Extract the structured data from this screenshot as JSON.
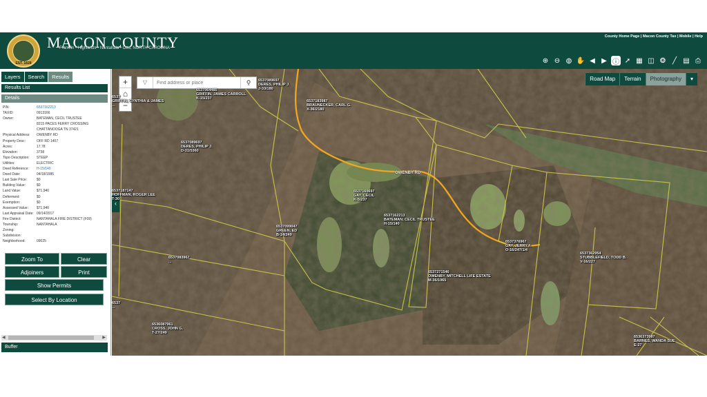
{
  "header": {
    "title": "MACON COUNTY",
    "subtitle": "Franklin • Highlands • Nantahala • Otto, NORTH CAROLINA",
    "seal_year": "EST. 1828",
    "links": [
      "County Home Page",
      "Macon County Tax",
      "Mobile",
      "Help"
    ],
    "tools": [
      "zoom-in-icon",
      "zoom-out-icon",
      "full-extent-icon",
      "pan-hand-icon",
      "previous-extent-icon",
      "next-extent-icon",
      "identify-icon",
      "select-arrow-icon",
      "map-layers-icon",
      "measure-area-icon",
      "streetview-icon",
      "measure-line-icon",
      "document-icon",
      "print-icon"
    ],
    "colors": {
      "header": "#0f4a3e",
      "accent": "#6d8a83"
    }
  },
  "sidebar": {
    "tabs": [
      "Layers",
      "Search",
      "Results"
    ],
    "active_tab": "Results",
    "results_list_label": "Results List",
    "details_label": "Details",
    "fields": [
      {
        "label": "PIN:",
        "value": "6537162213",
        "link": true
      },
      {
        "label": "TAXID:",
        "value": "0913166"
      },
      {
        "label": "Owner:",
        "value": "BATEMAN, CECIL TRUSTEE"
      },
      {
        "label": "",
        "value": "8215 PACES FERRY CROSSING"
      },
      {
        "label": "",
        "value": "CHATTANOOGA TN 37421"
      },
      {
        "label": "Physical Address:",
        "value": "OWENBY RD"
      },
      {
        "label": "Property Desc:",
        "value": "OFF RD 1407"
      },
      {
        "label": "Acres:",
        "value": "17.78"
      },
      {
        "label": "Elevation:",
        "value": "3738"
      },
      {
        "label": "Topo Description:",
        "value": "STEEP"
      },
      {
        "label": "Utilities:",
        "value": "ELECTRIC"
      },
      {
        "label": "Deed Reference:",
        "value": "H-15/140",
        "link": true
      },
      {
        "label": "Deed Date:",
        "value": "04/18/1985"
      },
      {
        "label": "Last Sale Price:",
        "value": "$0"
      },
      {
        "label": "Building Value:",
        "value": "$0"
      },
      {
        "label": "Land Value:",
        "value": "$71,940"
      },
      {
        "label": "Deferment:",
        "value": "$0"
      },
      {
        "label": "Exemption:",
        "value": "$0"
      },
      {
        "label": "Assessed Value:",
        "value": "$71,940"
      },
      {
        "label": "Last Appraisal Date:",
        "value": "09/14/2017"
      },
      {
        "label": "Fire District:",
        "value": "NANTAHALA FIRE DISTRICT (F09)"
      },
      {
        "label": "Township:",
        "value": "NANTAHALA"
      },
      {
        "label": "Zoning:",
        "value": ""
      },
      {
        "label": "Subdivision:",
        "value": ""
      },
      {
        "label": "Neighborhood:",
        "value": "09025"
      }
    ],
    "buttons": {
      "zoom_to": "Zoom To",
      "clear": "Clear",
      "adjoiners": "Adjoiners",
      "print": "Print",
      "show_permits": "Show Permits",
      "select_by_location": "Select By Location"
    },
    "buffer_label": "Buffer"
  },
  "map": {
    "search_placeholder": "Find address or place",
    "basemaps": [
      "Road Map",
      "Terrain",
      "Photography"
    ],
    "active_basemap": "Photography",
    "road_label": "OWENBY RD",
    "parcels": [
      {
        "id": "p1",
        "lines": [
          "6537089697",
          "DERES, PHILIP J.",
          "J-33/180"
        ]
      },
      {
        "id": "p2",
        "lines": [
          "6537064485",
          "GRIFFIN, JAMES CARROLL",
          "K-15/237"
        ]
      },
      {
        "id": "p3",
        "lines": [
          "6537",
          "GRIFFIN, CYNTHIA & JAMES",
          "..."
        ]
      },
      {
        "id": "p4",
        "lines": [
          "6537183987",
          "BRAUNECKER, CARL G.",
          "X-36/2180"
        ]
      },
      {
        "id": "p5",
        "lines": [
          "6537089697",
          "DERES, PHILIP J.",
          "D-31/5360"
        ]
      },
      {
        "id": "p6",
        "lines": [
          "6537187147",
          "HOFFMAN, ROGER LEE",
          "T-30"
        ]
      },
      {
        "id": "p7",
        "lines": [
          "6537160697",
          "GAY, CECIL",
          "K-5/237"
        ]
      },
      {
        "id": "p8",
        "lines": [
          "6537162213",
          "BATEMAN, CECIL TRUSTEE",
          "H-15/140"
        ]
      },
      {
        "id": "p9",
        "lines": [
          "6537099047",
          "GREEN, ED",
          "B-14/249"
        ]
      },
      {
        "id": "p10",
        "lines": [
          "6537376967",
          "GAY, JERRY F.",
          "O-16/247/1/4"
        ]
      },
      {
        "id": "p11",
        "lines": [
          "6537362954",
          "STUBBLEFIELD, TODD B.",
          "V-16/227"
        ]
      },
      {
        "id": "p12",
        "lines": [
          "6537083967",
          "..."
        ]
      },
      {
        "id": "p13",
        "lines": [
          "6537271546",
          "OWENBY, MITCHELL LIFE ESTATE",
          "M-36/1065"
        ]
      },
      {
        "id": "p14",
        "lines": [
          "6537",
          "..."
        ]
      },
      {
        "id": "p15",
        "lines": [
          "6536087961",
          "CROSS, JOHN G.",
          "T-27/249"
        ]
      },
      {
        "id": "p16",
        "lines": [
          "6536373987",
          "BARNES, WANDA SUE",
          "E-27"
        ]
      }
    ]
  }
}
